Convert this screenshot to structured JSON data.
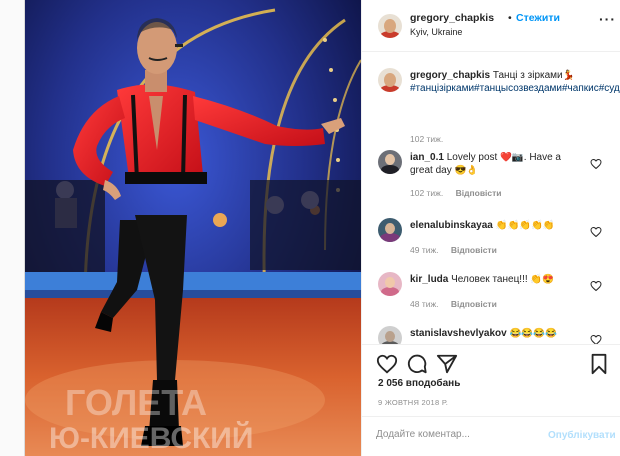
{
  "post": {
    "username": "gregory_chapkis",
    "separator": "•",
    "follow_label": "Стежити",
    "location": "Kyiv, Ukraine",
    "more_icon": "more-horizontal-icon"
  },
  "photo": {
    "watermark_top": "ГОЛЕТА",
    "watermark_bottom": "Ю-КИЕВСКИЙ",
    "colors": {
      "shirt": "#e02424",
      "stage": "#1e2a78",
      "floor": "#c7431f"
    }
  },
  "caption": {
    "username": "gregory_chapkis",
    "text": "Танці з зірками",
    "emoji": "💃",
    "hashtags": "#танцізірками#танцысозвездами#чапкис#судья#лучшийхореограф#",
    "time": "102 тиж."
  },
  "comments": [
    {
      "username": "ian_0.1",
      "text": "Lovely post",
      "emoji": "❤️📷",
      "text2": "Have a great day",
      "emoji2": "😎👌",
      "time": "102 тиж.",
      "reply": "Відповісти"
    },
    {
      "username": "elenalubinskayaa",
      "text": "",
      "emoji": "👏👏👏👏👏",
      "time": "49 тиж.",
      "reply": "Відповісти"
    },
    {
      "username": "kir_luda",
      "text": "Человек танец!!!",
      "emoji": "👏😍",
      "time": "48 тиж.",
      "reply": "Відповісти"
    },
    {
      "username": "stanislavshevlyakov",
      "text": "",
      "emoji": "😂😂😂😂",
      "time": "",
      "reply": ""
    }
  ],
  "actions": {
    "like_icon": "heart-icon",
    "comment_icon": "comment-icon",
    "share_icon": "share-icon",
    "save_icon": "bookmark-icon",
    "likes": "2 056 вподобань",
    "date": "9 ЖОВТНЯ 2018 Р."
  },
  "add_comment": {
    "placeholder": "Додайте коментар...",
    "publish_label": "Опублікувати"
  }
}
